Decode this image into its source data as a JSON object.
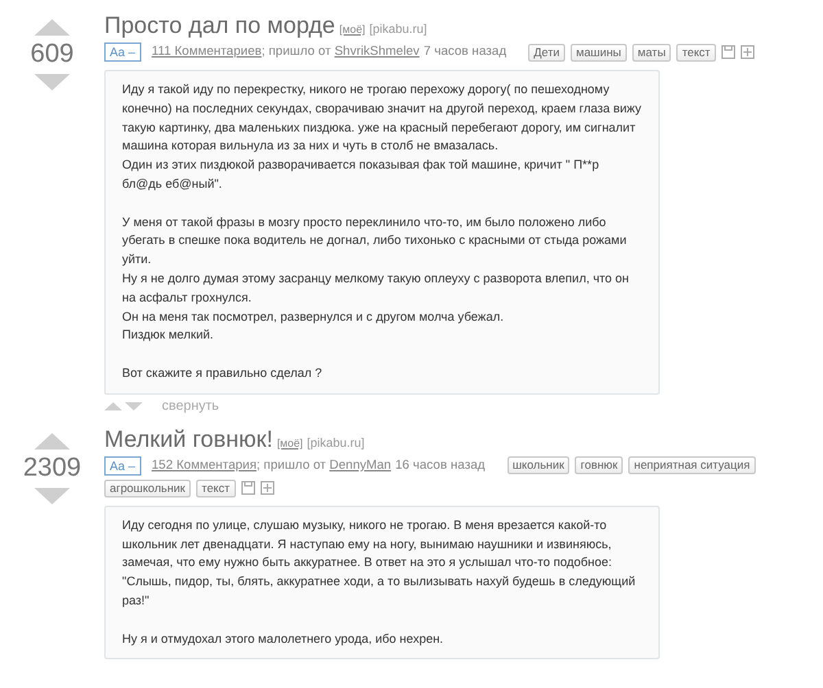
{
  "posts": [
    {
      "score": "609",
      "title": "Просто дал по морде",
      "mine_link": "[моё]",
      "source": "[pikabu.ru]",
      "font_toggle": "Aa –",
      "comments": "111 Комментариев",
      "came_from": "; пришло от",
      "author": "ShvrikShmelev",
      "time": "7 часов назад",
      "tags": [
        "Дети",
        "машины",
        "маты",
        "текст"
      ],
      "body": [
        [
          "Иду я такой иду по перекрестку, никого не трогаю перехожу дорогу( по пешеходному конечно) на последних секундах, сворачиваю значит на другой переход, краем глаза вижу такую картинку, два маленьких пиздюка. уже на красный перебегают дорогу, им сигналит машина которая вильнула из за них и чуть в столб не вмазалась.",
          "Один из этих пиздюкой разворачивается показывая фак той машине, кричит \" П**р бл@дь еб@ный\"."
        ],
        [
          "У меня от такой фразы в мозгу просто переклинило что-то, им было положено либо убегать в спешке пока водитель не догнал, либо тихонько с красными от стыда рожами уйти.",
          "Ну я не долго думая этому засранцу мелкому такую оплеуху с разворота влепил, что он на асфальт грохнулся.",
          "Он на меня так посмотрел, развернулся и с другом молча убежал.",
          "Пиздюк мелкий."
        ],
        [
          "Вот скажите я правильно сделал ?"
        ]
      ],
      "collapse": "свернуть"
    },
    {
      "score": "2309",
      "title": "Мелкий говнюк!",
      "mine_link": "[моё]",
      "source": "[pikabu.ru]",
      "font_toggle": "Aa –",
      "comments": "152 Комментария",
      "came_from": "; пришло от",
      "author": "DennyMan",
      "time": "16 часов назад",
      "tags": [
        "школьник",
        "говнюк",
        "неприятная ситуация",
        "агрошкольник",
        "текст"
      ],
      "body": [
        [
          "Иду сегодня по улице, слушаю музыку, никого не трогаю. В меня врезается какой-то школьник лет двенадцати. Я наступаю ему на ногу, вынимаю наушники и извиняюсь, замечая, что ему нужно быть аккуратнее. В ответ на это я услышал что-то подобное: \"Слышь, пидор, ты, блять, аккуратнее ходи, а то вылизывать нахуй будешь в следующий раз!\""
        ],
        [
          "Ну я и отмудохал этого малолетнего урода, ибо нехрен."
        ]
      ]
    }
  ]
}
